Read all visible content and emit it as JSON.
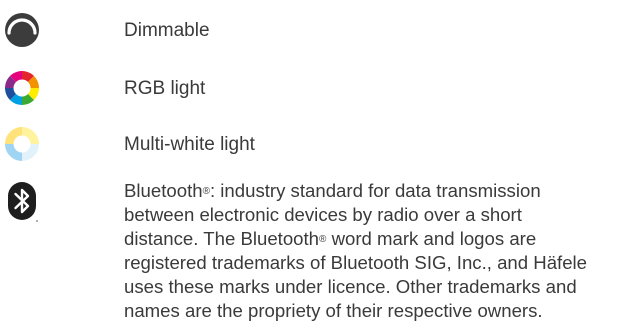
{
  "legend": {
    "dimmable": {
      "icon": "dimmable-icon",
      "label": "Dimmable",
      "color": "#3c3c3c"
    },
    "rgb": {
      "icon": "rgb-color-wheel-icon",
      "label": "RGB light",
      "colors": [
        "#e3262d",
        "#f39200",
        "#ffed00",
        "#3aaa35",
        "#00a0e3",
        "#1d4f9c",
        "#8a2b8b",
        "#e5007d"
      ]
    },
    "multiwhite": {
      "icon": "multi-white-icon",
      "label": "Multi-white light",
      "colors": [
        "#fff3a0",
        "#e2f2fb",
        "#9fd4f2",
        "#ffe27a"
      ]
    },
    "bluetooth": {
      "icon": "bluetooth-icon",
      "color": "#1e1e1e",
      "lines": [
        "Bluetooth®: industry standard for data transmission",
        "between electronic devices by radio over a short",
        "distance. The Bluetooth® word mark and logos are",
        "registered trademarks of Bluetooth SIG, Inc., and Häfele",
        "uses these marks under licence. Other trademarks and",
        "names are the propriety of their respective owners."
      ]
    }
  }
}
